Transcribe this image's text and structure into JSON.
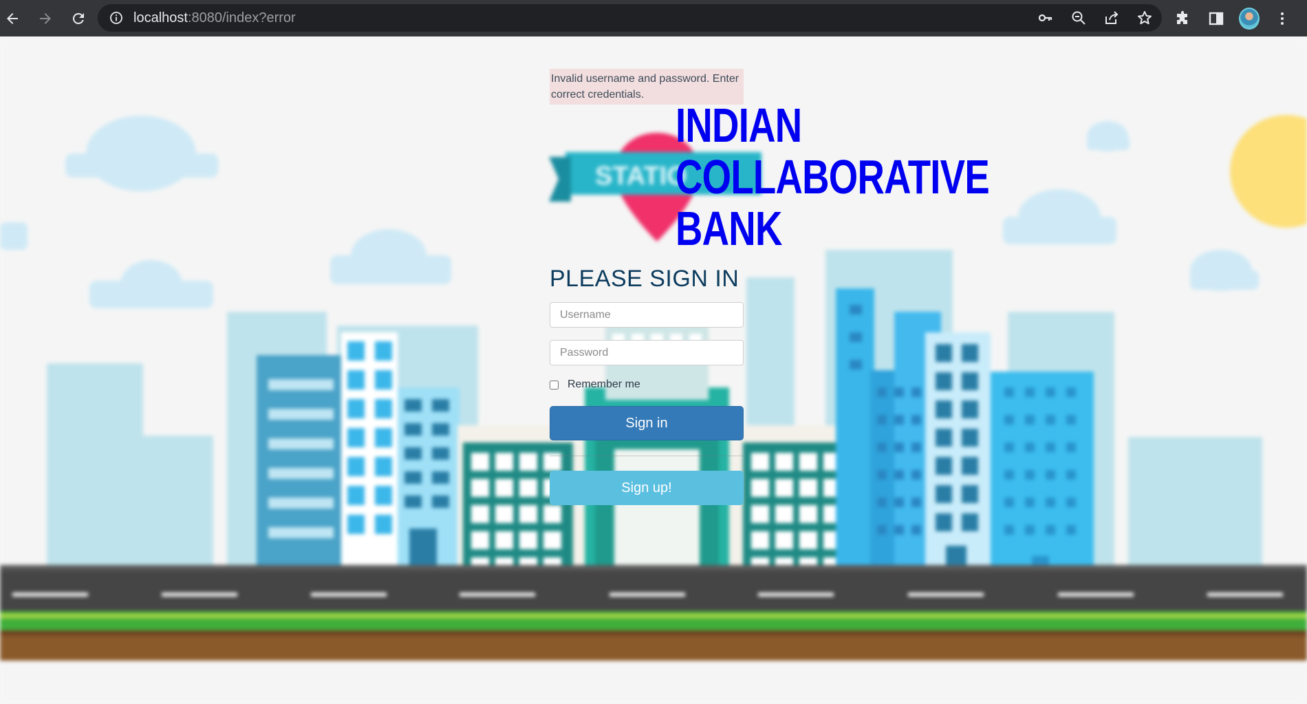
{
  "browser": {
    "url_host": "localhost",
    "url_rest": ":8080/index?error",
    "icons": [
      "back-icon",
      "forward-icon",
      "reload-icon",
      "site-info-icon",
      "key-icon",
      "zoom-icon",
      "share-icon",
      "star-icon",
      "extensions-icon",
      "side-panel-icon",
      "avatar",
      "menu-icon"
    ]
  },
  "login": {
    "error_message": "Invalid username and password. Enter correct credentials.",
    "bank_title": [
      "INDIAN",
      "COLLABORATIVE",
      "BANK"
    ],
    "heading": "PLEASE SIGN IN",
    "username_placeholder": "Username",
    "password_placeholder": "Password",
    "remember_label": "Remember me",
    "signin_label": "Sign in",
    "signup_label": "Sign up!"
  },
  "background": {
    "sign_text": "STATIO",
    "colors": {
      "sky": "#f5f5f5",
      "cloud": "#cfeaf6",
      "sun": "#fde07a",
      "road": "#454545",
      "grass": "#3fae3a",
      "soil": "#8b5a2b"
    }
  }
}
